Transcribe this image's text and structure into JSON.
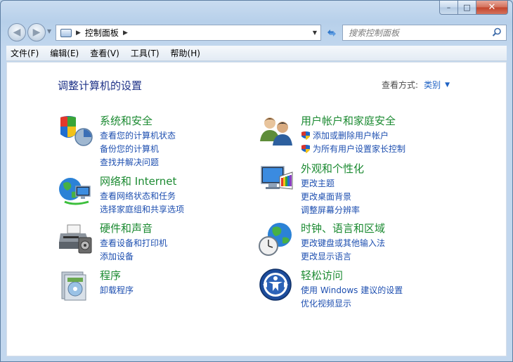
{
  "window": {
    "caption": {
      "minimize": "–",
      "maximize": "□",
      "close": "✕"
    }
  },
  "nav": {
    "back": "◀",
    "forward": "▶",
    "breadcrumb": [
      "控制面板"
    ],
    "search_placeholder": "搜索控制面板"
  },
  "menu": [
    "文件(F)",
    "编辑(E)",
    "查看(V)",
    "工具(T)",
    "帮助(H)"
  ],
  "page": {
    "title": "调整计算机的设置",
    "view_by_label": "查看方式:",
    "view_by_value": "类别"
  },
  "categories": [
    {
      "icon": "security-shield-icon",
      "title": "系统和安全",
      "links": [
        {
          "text": "查看您的计算机状态"
        },
        {
          "text": "备份您的计算机"
        },
        {
          "text": "查找并解决问题"
        }
      ]
    },
    {
      "icon": "network-globe-icon",
      "title": "网络和 Internet",
      "links": [
        {
          "text": "查看网络状态和任务"
        },
        {
          "text": "选择家庭组和共享选项"
        }
      ]
    },
    {
      "icon": "printer-icon",
      "title": "硬件和声音",
      "links": [
        {
          "text": "查看设备和打印机"
        },
        {
          "text": "添加设备"
        }
      ]
    },
    {
      "icon": "programs-icon",
      "title": "程序",
      "links": [
        {
          "text": "卸载程序"
        }
      ]
    },
    {
      "icon": "user-accounts-icon",
      "title": "用户帐户和家庭安全",
      "links": [
        {
          "text": "添加或删除用户帐户",
          "shield": true
        },
        {
          "text": "为所有用户设置家长控制",
          "shield": true
        }
      ]
    },
    {
      "icon": "appearance-monitor-icon",
      "title": "外观和个性化",
      "links": [
        {
          "text": "更改主题"
        },
        {
          "text": "更改桌面背景"
        },
        {
          "text": "调整屏幕分辨率"
        }
      ]
    },
    {
      "icon": "clock-globe-icon",
      "title": "时钟、语言和区域",
      "links": [
        {
          "text": "更改键盘或其他输入法"
        },
        {
          "text": "更改显示语言"
        }
      ]
    },
    {
      "icon": "ease-of-access-icon",
      "title": "轻松访问",
      "links": [
        {
          "text": "使用 Windows 建议的设置"
        },
        {
          "text": "优化视频显示"
        }
      ]
    }
  ]
}
